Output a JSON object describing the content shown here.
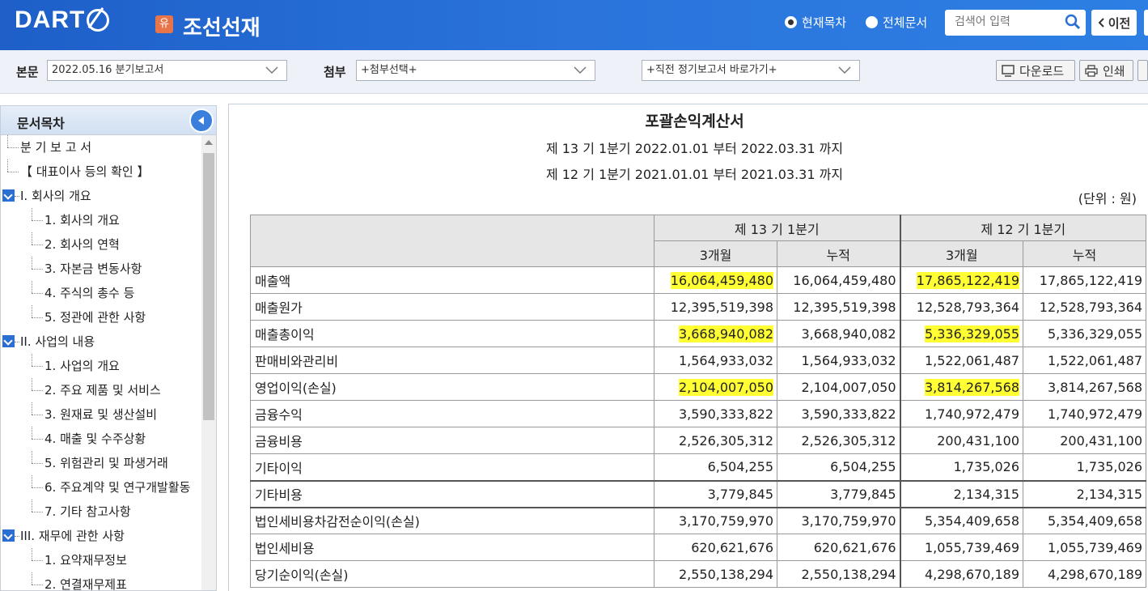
{
  "header": {
    "logo_text": "DART",
    "company_badge": "유",
    "company_name": "조선선재",
    "radio_current": "현재목차",
    "radio_all": "전체문서",
    "search_placeholder": "검색어 입력",
    "prev_label": "이전"
  },
  "toolbar": {
    "main_label": "본문",
    "main_select": "2022.05.16  분기보고서",
    "attach_label": "첨부",
    "attach_select": "+첨부선택+",
    "report_select": "+직전 정기보고서 바로가기+",
    "download_label": "다운로드",
    "print_label": "인쇄"
  },
  "sidebar": {
    "title": "문서목차",
    "items": [
      {
        "label": "분 기 보 고 서",
        "level": 0,
        "expand": false
      },
      {
        "label": "【 대표이사 등의 확인 】",
        "level": 0,
        "expand": false
      },
      {
        "label": "I. 회사의 개요",
        "level": 0,
        "expand": true
      },
      {
        "label": "1. 회사의 개요",
        "level": 1,
        "expand": false
      },
      {
        "label": "2. 회사의 연혁",
        "level": 1,
        "expand": false
      },
      {
        "label": "3. 자본금 변동사항",
        "level": 1,
        "expand": false
      },
      {
        "label": "4. 주식의 총수 등",
        "level": 1,
        "expand": false
      },
      {
        "label": "5. 정관에 관한 사항",
        "level": 1,
        "expand": false
      },
      {
        "label": "II. 사업의 내용",
        "level": 0,
        "expand": true
      },
      {
        "label": "1. 사업의 개요",
        "level": 1,
        "expand": false
      },
      {
        "label": "2. 주요 제품 및 서비스",
        "level": 1,
        "expand": false
      },
      {
        "label": "3. 원재료 및 생산설비",
        "level": 1,
        "expand": false
      },
      {
        "label": "4. 매출 및 수주상황",
        "level": 1,
        "expand": false
      },
      {
        "label": "5. 위험관리 및 파생거래",
        "level": 1,
        "expand": false
      },
      {
        "label": "6. 주요계약 및 연구개발활동",
        "level": 1,
        "expand": false
      },
      {
        "label": "7. 기타 참고사항",
        "level": 1,
        "expand": false
      },
      {
        "label": "III. 재무에 관한 사항",
        "level": 0,
        "expand": true
      },
      {
        "label": "1. 요약재무정보",
        "level": 1,
        "expand": false
      },
      {
        "label": "2. 연결재무제표",
        "level": 1,
        "expand": false
      }
    ]
  },
  "document": {
    "title": "포괄손익계산서",
    "period1": "제 13 기 1분기 2022.01.01 부터 2022.03.31 까지",
    "period2": "제 12 기 1분기 2021.01.01 부터 2021.03.31 까지",
    "unit": "(단위 : 원)",
    "col_group1": "제 13 기 1분기",
    "col_group2": "제 12 기 1분기",
    "sub_3m": "3개월",
    "sub_cum": "누적",
    "rows": [
      {
        "label": "매출액",
        "v": [
          "16,064,459,480",
          "16,064,459,480",
          "17,865,122,419",
          "17,865,122,419"
        ],
        "hl": true,
        "bold_top": false
      },
      {
        "label": "매출원가",
        "v": [
          "12,395,519,398",
          "12,395,519,398",
          "12,528,793,364",
          "12,528,793,364"
        ],
        "hl": false,
        "bold_top": false
      },
      {
        "label": "매출총이익",
        "v": [
          "3,668,940,082",
          "3,668,940,082",
          "5,336,329,055",
          "5,336,329,055"
        ],
        "hl": true,
        "bold_top": false
      },
      {
        "label": "판매비와관리비",
        "v": [
          "1,564,933,032",
          "1,564,933,032",
          "1,522,061,487",
          "1,522,061,487"
        ],
        "hl": false,
        "bold_top": false
      },
      {
        "label": "영업이익(손실)",
        "v": [
          "2,104,007,050",
          "2,104,007,050",
          "3,814,267,568",
          "3,814,267,568"
        ],
        "hl": true,
        "bold_top": false
      },
      {
        "label": "금융수익",
        "v": [
          "3,590,333,822",
          "3,590,333,822",
          "1,740,972,479",
          "1,740,972,479"
        ],
        "hl": false,
        "bold_top": false
      },
      {
        "label": "금융비용",
        "v": [
          "2,526,305,312",
          "2,526,305,312",
          "200,431,100",
          "200,431,100"
        ],
        "hl": false,
        "bold_top": false
      },
      {
        "label": "기타이익",
        "v": [
          "6,504,255",
          "6,504,255",
          "1,735,026",
          "1,735,026"
        ],
        "hl": false,
        "bold_top": false
      },
      {
        "label": "기타비용",
        "v": [
          "3,779,845",
          "3,779,845",
          "2,134,315",
          "2,134,315"
        ],
        "hl": false,
        "bold_top": true
      },
      {
        "label": "법인세비용차감전순이익(손실)",
        "v": [
          "3,170,759,970",
          "3,170,759,970",
          "5,354,409,658",
          "5,354,409,658"
        ],
        "hl": false,
        "bold_top": true
      },
      {
        "label": "법인세비용",
        "v": [
          "620,621,676",
          "620,621,676",
          "1,055,739,469",
          "1,055,739,469"
        ],
        "hl": false,
        "bold_top": false
      },
      {
        "label": "당기순이익(손실)",
        "v": [
          "2,550,138,294",
          "2,550,138,294",
          "4,298,670,189",
          "4,298,670,189"
        ],
        "hl": false,
        "bold_top": false
      }
    ]
  },
  "colors": {
    "header_blue": "#2a74dc",
    "highlight": "#ffff33",
    "toolbar_bg": "#eef2f8"
  }
}
